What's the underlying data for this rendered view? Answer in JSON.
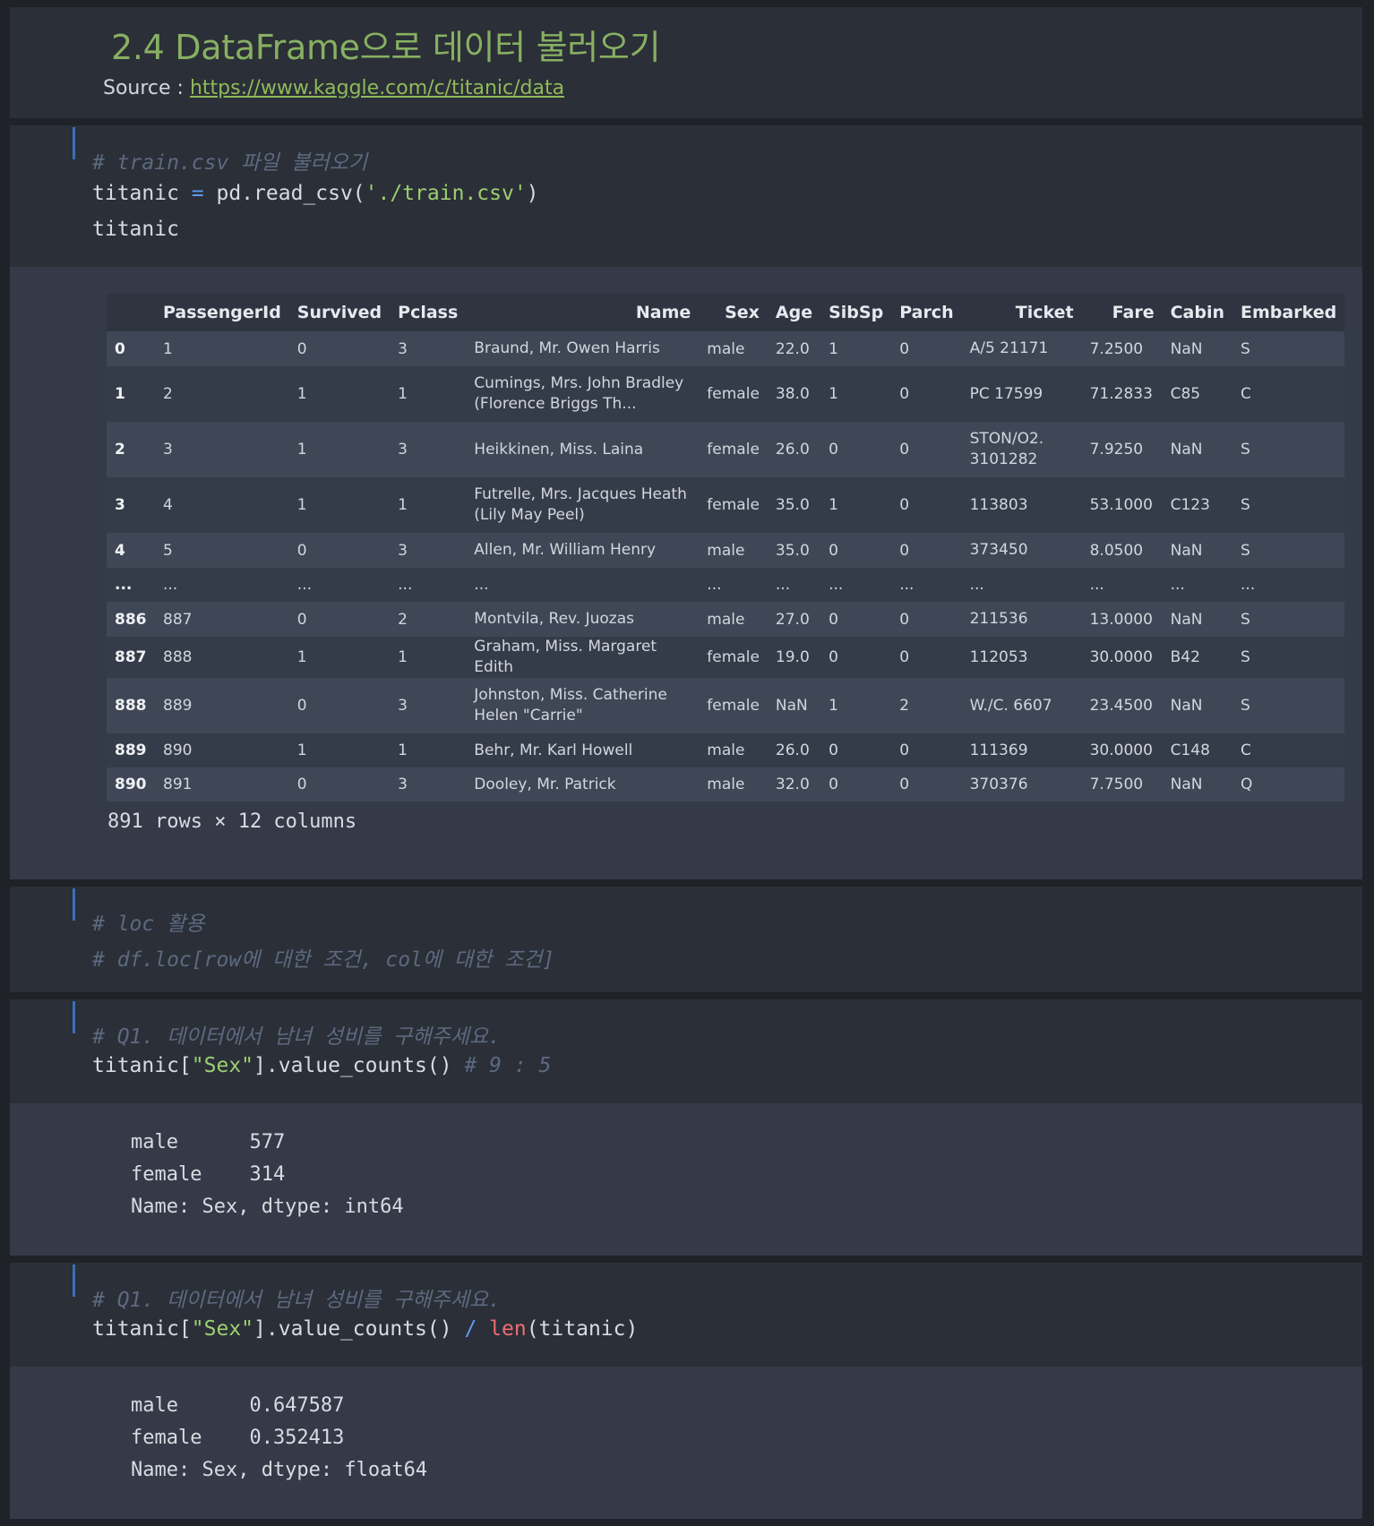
{
  "markdown": {
    "title": "2.4 DataFrame으로 데이터 불러오기",
    "source_label": "Source : ",
    "source_link": "https://www.kaggle.com/c/titanic/data"
  },
  "cell1": {
    "comment": "# train.csv 파일 불러오기",
    "line1_a": "titanic ",
    "line1_op": "=",
    "line1_b": " pd.read_csv(",
    "line1_str": "'./train.csv'",
    "line1_c": ")",
    "line2": "titanic"
  },
  "dataframe": {
    "columns": [
      "PassengerId",
      "Survived",
      "Pclass",
      "Name",
      "Sex",
      "Age",
      "SibSp",
      "Parch",
      "Ticket",
      "Fare",
      "Cabin",
      "Embarked"
    ],
    "rows": [
      {
        "index": "0",
        "cells": [
          "1",
          "0",
          "3",
          "Braund, Mr. Owen Harris",
          "male",
          "22.0",
          "1",
          "0",
          "A/5 21171",
          "7.2500",
          "NaN",
          "S"
        ]
      },
      {
        "index": "1",
        "cells": [
          "2",
          "1",
          "1",
          "Cumings, Mrs. John Bradley (Florence Briggs Th...",
          "female",
          "38.0",
          "1",
          "0",
          "PC 17599",
          "71.2833",
          "C85",
          "C"
        ]
      },
      {
        "index": "2",
        "cells": [
          "3",
          "1",
          "3",
          "Heikkinen, Miss. Laina",
          "female",
          "26.0",
          "0",
          "0",
          "STON/O2. 3101282",
          "7.9250",
          "NaN",
          "S"
        ]
      },
      {
        "index": "3",
        "cells": [
          "4",
          "1",
          "1",
          "Futrelle, Mrs. Jacques Heath (Lily May Peel)",
          "female",
          "35.0",
          "1",
          "0",
          "113803",
          "53.1000",
          "C123",
          "S"
        ]
      },
      {
        "index": "4",
        "cells": [
          "5",
          "0",
          "3",
          "Allen, Mr. William Henry",
          "male",
          "35.0",
          "0",
          "0",
          "373450",
          "8.0500",
          "NaN",
          "S"
        ]
      },
      {
        "index": "...",
        "cells": [
          "...",
          "...",
          "...",
          "...",
          "...",
          "...",
          "...",
          "...",
          "...",
          "...",
          "...",
          "..."
        ]
      },
      {
        "index": "886",
        "cells": [
          "887",
          "0",
          "2",
          "Montvila, Rev. Juozas",
          "male",
          "27.0",
          "0",
          "0",
          "211536",
          "13.0000",
          "NaN",
          "S"
        ]
      },
      {
        "index": "887",
        "cells": [
          "888",
          "1",
          "1",
          "Graham, Miss. Margaret Edith",
          "female",
          "19.0",
          "0",
          "0",
          "112053",
          "30.0000",
          "B42",
          "S"
        ]
      },
      {
        "index": "888",
        "cells": [
          "889",
          "0",
          "3",
          "Johnston, Miss. Catherine Helen \"Carrie\"",
          "female",
          "NaN",
          "1",
          "2",
          "W./C. 6607",
          "23.4500",
          "NaN",
          "S"
        ]
      },
      {
        "index": "889",
        "cells": [
          "890",
          "1",
          "1",
          "Behr, Mr. Karl Howell",
          "male",
          "26.0",
          "0",
          "0",
          "111369",
          "30.0000",
          "C148",
          "C"
        ]
      },
      {
        "index": "890",
        "cells": [
          "891",
          "0",
          "3",
          "Dooley, Mr. Patrick",
          "male",
          "32.0",
          "0",
          "0",
          "370376",
          "7.7500",
          "NaN",
          "Q"
        ]
      }
    ],
    "shape_text": "891 rows × 12 columns"
  },
  "cell2": {
    "comment1": "# loc 활용",
    "comment2": "# df.loc[row에 대한 조건, col에 대한 조건]"
  },
  "cell3": {
    "comment": "# Q1. 데이터에서 남녀 성비를 구해주세요.",
    "code_a": "titanic[",
    "code_str": "\"Sex\"",
    "code_b": "].value_counts() ",
    "code_comment": "# 9 : 5",
    "output": "male      577\nfemale    314\nName: Sex, dtype: int64"
  },
  "cell4": {
    "comment": "# Q1. 데이터에서 남녀 성비를 구해주세요.",
    "code_a": "titanic[",
    "code_str": "\"Sex\"",
    "code_b": "].value_counts() ",
    "code_op": "/",
    "code_sp": " ",
    "code_builtin": "len",
    "code_c": "(titanic)",
    "output": "male      0.647587\nfemale    0.352413\nName: Sex, dtype: float64"
  }
}
